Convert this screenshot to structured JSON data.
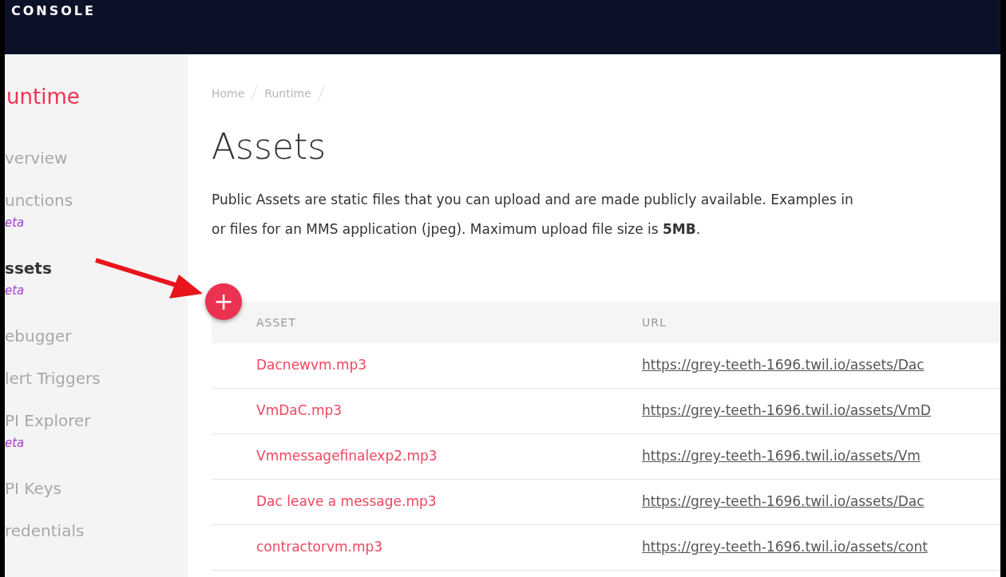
{
  "header": {
    "title": "CONSOLE"
  },
  "sidebar": {
    "title": "untime",
    "items": [
      {
        "label": "verview",
        "selected": false
      },
      {
        "label": "unctions",
        "badge": "eta",
        "selected": false
      },
      {
        "label": "ssets",
        "badge": "eta",
        "selected": true
      },
      {
        "label": "ebugger",
        "selected": false
      },
      {
        "label": "lert Triggers",
        "selected": false
      },
      {
        "label": "PI Explorer",
        "badge": "eta",
        "selected": false
      },
      {
        "label": "PI Keys",
        "selected": false
      },
      {
        "label": "redentials",
        "selected": false
      }
    ]
  },
  "breadcrumb": [
    "Home",
    "Runtime"
  ],
  "page_title": "Assets",
  "description": [
    "Public Assets are static files that you can upload and are made publicly available. Examples in",
    "or files for an MMS application (jpeg). Maximum upload file size is **5MB**."
  ],
  "add_button": {
    "label": "+"
  },
  "table": {
    "columns": [
      "ASSET",
      "URL"
    ],
    "rows": [
      {
        "asset": "Dacnewvm.mp3",
        "url": "https://grey-teeth-1696.twil.io/assets/Dac"
      },
      {
        "asset": "VmDaC.mp3",
        "url": "https://grey-teeth-1696.twil.io/assets/VmD"
      },
      {
        "asset": "Vmmessagefinalexp2.mp3",
        "url": "https://grey-teeth-1696.twil.io/assets/Vm"
      },
      {
        "asset": "Dac leave a message.mp3",
        "url": "https://grey-teeth-1696.twil.io/assets/Dac"
      },
      {
        "asset": "contractorvm.mp3",
        "url": "https://grey-teeth-1696.twil.io/assets/cont"
      }
    ]
  }
}
